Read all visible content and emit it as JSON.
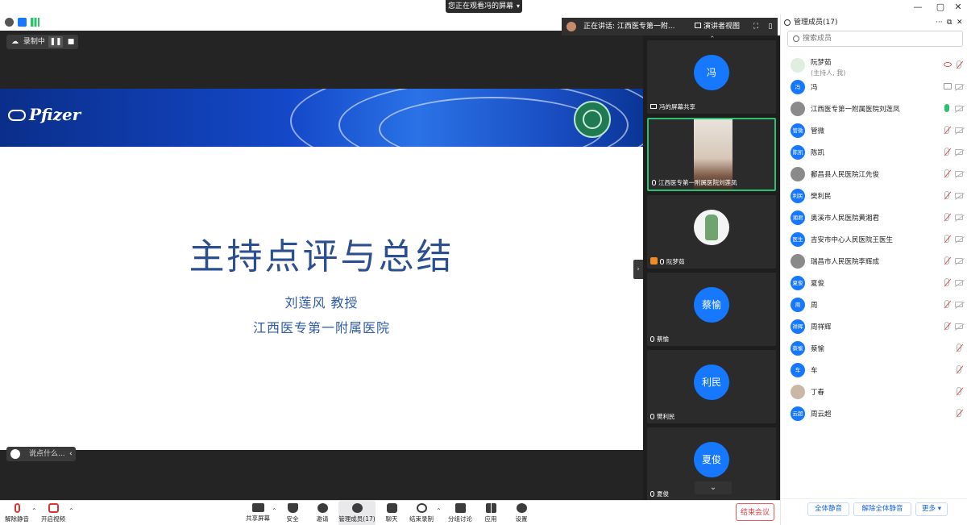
{
  "window": {
    "viewing_banner": "您正在观看冯的屏幕",
    "controls": [
      "—",
      "▢",
      "✕"
    ]
  },
  "recording": {
    "label": "录制中",
    "pause_icon": "pause-icon",
    "stop_icon": "stop-icon"
  },
  "speaker_bar": {
    "text": "正在讲话: 江西医专第一附...",
    "view_label": "演讲者视图"
  },
  "slide": {
    "logo_text": "Pfizer",
    "title": "主持点评与总结",
    "presenter": "刘莲风  教授",
    "hospital": "江西医专第一附属医院"
  },
  "chat": {
    "placeholder": "说点什么..."
  },
  "gallery": [
    {
      "type": "avatar",
      "avatar": "冯",
      "name": "冯的屏幕共享",
      "icon": "screen-share-icon"
    },
    {
      "type": "video",
      "name": "江西医专第一附属医院刘莲凤",
      "icon": "mic-icon",
      "active": true
    },
    {
      "type": "pet",
      "name": "阮梦茹",
      "icon": "mic-icon",
      "host": true
    },
    {
      "type": "avatar",
      "avatar": "蔡愉",
      "name": "蔡愉",
      "icon": "mic-off-icon"
    },
    {
      "type": "avatar",
      "avatar": "利民",
      "name": "樊利民",
      "icon": "mic-off-icon"
    },
    {
      "type": "avatar",
      "avatar": "夏俊",
      "name": "夏俊",
      "icon": "mic-off-icon"
    }
  ],
  "panel": {
    "title": "管理成员(17)",
    "search_placeholder": "搜索成员",
    "participants": [
      {
        "name": "阮梦茹",
        "sub": "(主持人, 我)",
        "avatar": "",
        "kind": "pet",
        "cam": "off",
        "mic": "off",
        "extra": "eye"
      },
      {
        "name": "冯",
        "avatar": "冯",
        "kind": "text",
        "cam": "off",
        "mic": "",
        "extra": "share"
      },
      {
        "name": "江西医专第一附属医院刘莲凤",
        "avatar": "",
        "kind": "img",
        "cam": "off",
        "mic": "on"
      },
      {
        "name": "管微",
        "avatar": "管微",
        "kind": "text",
        "cam": "off",
        "mic": "off"
      },
      {
        "name": "陈凯",
        "avatar": "陈凯",
        "kind": "text",
        "cam": "off",
        "mic": "off"
      },
      {
        "name": "鄱昌县人民医院江先俊",
        "avatar": "",
        "kind": "img",
        "cam": "off",
        "mic": "off"
      },
      {
        "name": "樊利民",
        "avatar": "利民",
        "kind": "text",
        "cam": "off",
        "mic": "off"
      },
      {
        "name": "奥溪市人民医院黄湘君",
        "avatar": "湘君",
        "kind": "text",
        "cam": "off",
        "mic": "off"
      },
      {
        "name": "吉安市中心人民医院王医生",
        "avatar": "医生",
        "kind": "text",
        "cam": "off",
        "mic": "off"
      },
      {
        "name": "瑞昌市人民医院李辉成",
        "avatar": "",
        "kind": "img",
        "cam": "off",
        "mic": "off"
      },
      {
        "name": "夏俊",
        "avatar": "夏俊",
        "kind": "text",
        "cam": "off",
        "mic": "off"
      },
      {
        "name": "周",
        "avatar": "周",
        "kind": "text",
        "cam": "off",
        "mic": "off"
      },
      {
        "name": "周祥辉",
        "avatar": "祥辉",
        "kind": "text",
        "cam": "off",
        "mic": "off"
      },
      {
        "name": "蔡愉",
        "avatar": "蔡愉",
        "kind": "text",
        "cam": "",
        "mic": "off"
      },
      {
        "name": "车",
        "avatar": "车",
        "kind": "text",
        "cam": "",
        "mic": "off"
      },
      {
        "name": "丁春",
        "avatar": "",
        "kind": "img",
        "cam": "",
        "mic": "off"
      },
      {
        "name": "周云超",
        "avatar": "云超",
        "kind": "text",
        "cam": "",
        "mic": "off"
      }
    ],
    "footer": {
      "mute_all": "全体静音",
      "unmute_all": "解除全体静音",
      "more": "更多 ▾"
    }
  },
  "toolbar": {
    "unmute": "解除静音",
    "start_video": "开启视频",
    "share_screen": "共享屏幕",
    "security": "安全",
    "invite": "邀请",
    "participants": "管理成员(17)",
    "chat": "聊天",
    "end_recording": "结束录制",
    "breakout": "分组讨论",
    "apps": "应用",
    "settings": "设置",
    "end_meeting": "结束会议"
  },
  "colors": {
    "accent": "#1677ff",
    "danger": "#e03e3e",
    "active_tile": "#2fbf71"
  }
}
